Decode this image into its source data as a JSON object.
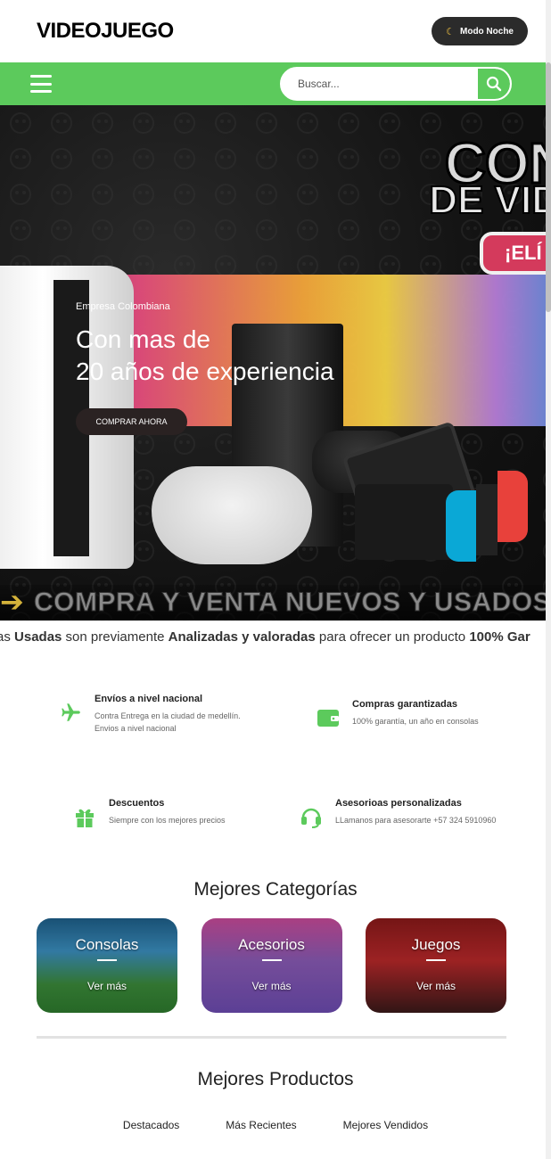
{
  "header": {
    "logo": "VIDEOJUEGO",
    "night_mode_label": "Modo Noche"
  },
  "navbar": {
    "search_placeholder": "Buscar..."
  },
  "hero": {
    "bg_text_1": "CON",
    "bg_text_2": "DE VID",
    "bg_pill": "¡ELÍ",
    "subtitle": "Empresa Colombiana",
    "title_line_1": "Con mas de",
    "title_line_2": "20 años de experiencia",
    "cta": "COMPRAR AHORA",
    "banner": "COMPRA Y VENTA NUEVOS Y USADOS",
    "strip_parts": [
      "as ",
      "Usadas",
      " son previamente ",
      "Analizadas y valoradas",
      " para ofrecer un producto ",
      "100% Gar"
    ]
  },
  "features": [
    {
      "title": "Envíos a nivel nacional",
      "desc_1": "Contra Entrega en la ciudad de medellín.",
      "desc_2": "Envios a nivel nacional",
      "icon": "plane-icon"
    },
    {
      "title": "Compras garantizadas",
      "desc_1": "100% garantía, un año en consolas",
      "icon": "wallet-icon"
    },
    {
      "title": "Descuentos",
      "desc_1": "Siempre con los mejores precios",
      "icon": "gift-icon"
    },
    {
      "title": "Asesorioas personalizadas",
      "desc_1": "LLamanos para asesorarte +57 324 5910960",
      "icon": "headset-icon"
    }
  ],
  "categories": {
    "title": "Mejores Categorías",
    "items": [
      {
        "name": "Consolas",
        "link": "Ver más"
      },
      {
        "name": "Acesorios",
        "link": "Ver más"
      },
      {
        "name": "Juegos",
        "link": "Ver más"
      }
    ]
  },
  "products": {
    "title": "Mejores Productos",
    "tabs": [
      "Destacados",
      "Más Recientes",
      "Mejores Vendidos"
    ]
  },
  "colors": {
    "accent": "#5cca5c",
    "night_button": "#2b2b2b"
  }
}
